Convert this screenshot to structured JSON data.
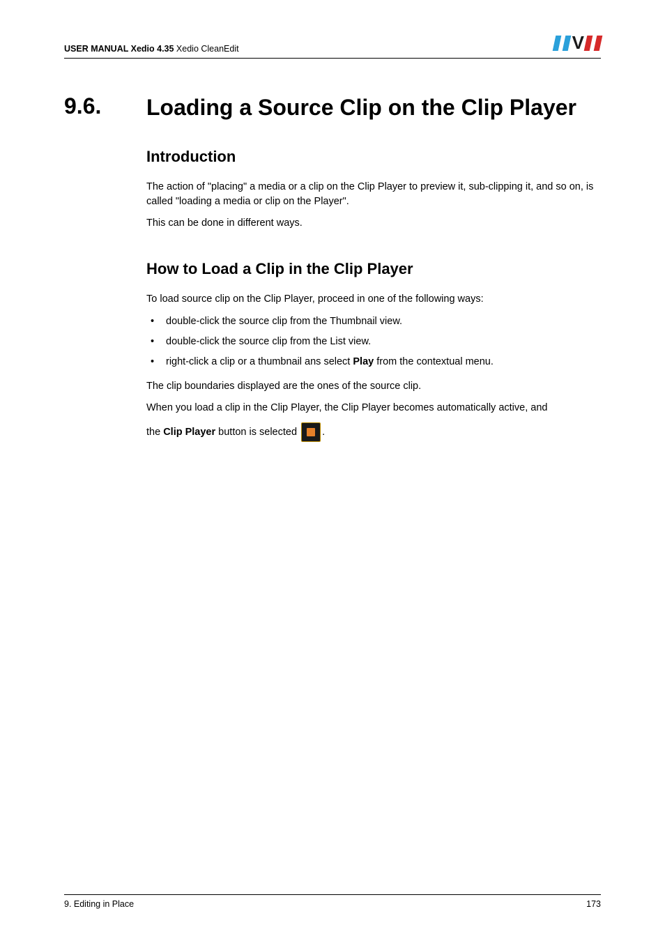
{
  "header": {
    "manual_bold": "USER MANUAL Xedio 4.35",
    "manual_rest": "  Xedio CleanEdit",
    "logo_alt": "EVS"
  },
  "section": {
    "number": "9.6.",
    "title": "Loading a Source Clip on the Clip Player"
  },
  "intro": {
    "heading": "Introduction",
    "para1": "The action of \"placing\" a media or a clip on the Clip Player to preview it, sub-clipping it, and so on, is called \"loading a media or clip on the Player\".",
    "para2": "This can be done in different ways."
  },
  "howto": {
    "heading": "How to Load a Clip in the Clip Player",
    "lead": "To load source clip on the Clip Player, proceed in one of the following ways:",
    "bullets": [
      "double-click the source clip from the Thumbnail view.",
      "double-click the source clip from the List view.",
      {
        "pre": "right-click a clip or a thumbnail ans select ",
        "bold": "Play",
        "post": " from the contextual menu."
      }
    ],
    "after1": "The clip boundaries displayed are the ones of the source clip.",
    "after2": "When you load a clip in the Clip Player, the Clip Player becomes automatically active, and",
    "after3_pre": "the ",
    "after3_bold": "Clip Player",
    "after3_post": " button is selected ",
    "after3_tail": "."
  },
  "footer": {
    "left": "9. Editing in Place",
    "right": "173"
  }
}
